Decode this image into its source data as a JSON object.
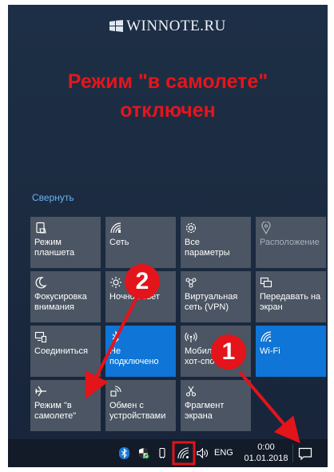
{
  "watermark": "WINNOTE.RU",
  "headline": {
    "line1": "Режим \"в самолете\"",
    "line2": "отключен"
  },
  "action_center": {
    "collapse_label": "Свернуть",
    "tiles": [
      {
        "label": "Режим планшета",
        "icon": "tablet-mode-icon",
        "state": "off"
      },
      {
        "label": "Сеть",
        "icon": "network-icon",
        "state": "off"
      },
      {
        "label": "Все параметры",
        "icon": "settings-gear-icon",
        "state": "off"
      },
      {
        "label": "Расположение",
        "icon": "location-icon",
        "state": "disabled"
      },
      {
        "label": "Фокусировка внимания",
        "icon": "focus-moon-icon",
        "state": "off"
      },
      {
        "label": "Ночной свет",
        "icon": "night-light-icon",
        "state": "off"
      },
      {
        "label": "Виртуальная сеть (VPN)",
        "icon": "vpn-icon",
        "state": "off"
      },
      {
        "label": "Передавать на экран",
        "icon": "project-screen-icon",
        "state": "off"
      },
      {
        "label": "Соединиться",
        "icon": "connect-icon",
        "state": "off"
      },
      {
        "label": "Не подключено",
        "icon": "bluetooth-icon",
        "state": "on"
      },
      {
        "label": "Мобильный хот-спот",
        "icon": "mobile-hotspot-icon",
        "state": "off"
      },
      {
        "label": "Wi-Fi",
        "icon": "wifi-icon",
        "state": "on"
      },
      {
        "label": "Режим \"в самолете\"",
        "icon": "airplane-icon",
        "state": "off"
      },
      {
        "label": "Обмен с устройствами",
        "icon": "nearby-share-icon",
        "state": "off"
      },
      {
        "label": "Фрагмент экрана",
        "icon": "screen-snip-icon",
        "state": "off"
      }
    ]
  },
  "taskbar": {
    "language": "ENG",
    "time": "0:00",
    "date": "01.01.2018"
  },
  "annotations": {
    "marker1": "1",
    "marker2": "2"
  },
  "colors": {
    "panel_bg": "#1b2a3f",
    "tile_bg": "#4b5563",
    "tile_active": "#0f75d6",
    "headline": "#e8141b",
    "annotation": "#e3141a",
    "link": "#6cb4f5"
  }
}
